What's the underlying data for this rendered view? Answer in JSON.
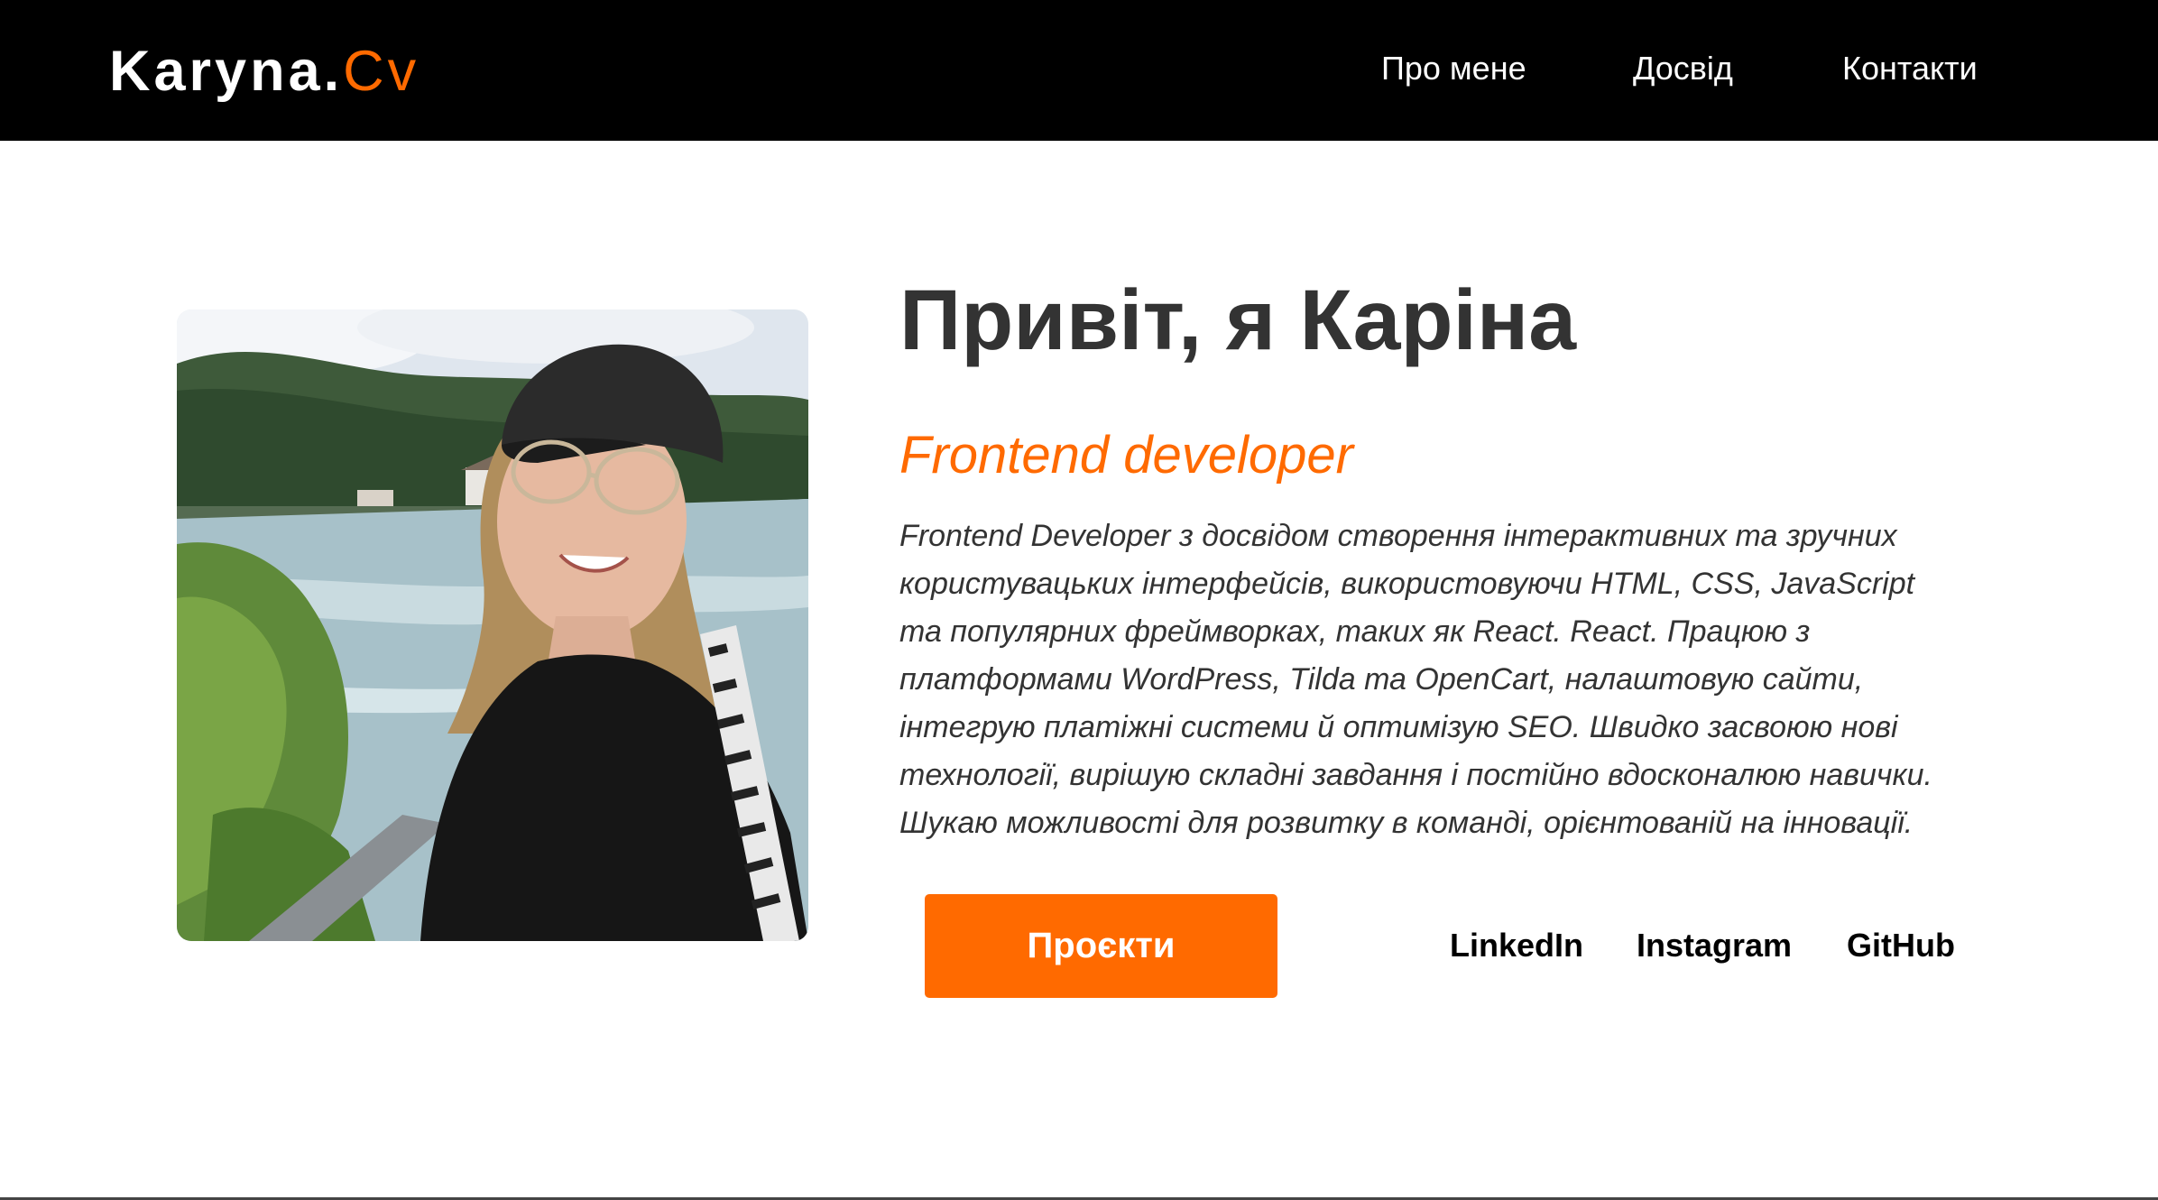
{
  "header": {
    "logo_main": "Karyna.",
    "logo_accent": "Cv",
    "nav": [
      {
        "label": "Про мене"
      },
      {
        "label": "Досвід"
      },
      {
        "label": "Контакти"
      }
    ]
  },
  "hero": {
    "title": "Привіт, я Каріна",
    "subtitle": "Frontend developer",
    "description_lines": [
      "Frontend Developer з досвідом створення інтерактивних та зручних",
      "користувацьких інтерфейсів, використовуючи HTML, CSS, JavaScript",
      "та популярних фреймворках, таких як React. React. Працюю з",
      "платформами WordPress, Tilda та OpenCart, налаштовую сайти,",
      "інтегрую платіжні системи й оптимізую SEO. Швидко засвоюю нові",
      "технології, вирішую складні завдання і постійно вдосконалюю навички.",
      "Шукаю можливості для розвитку в команді, орієнтованій на інновації."
    ],
    "projects_button": "Проєкти",
    "social": [
      {
        "label": "LinkedIn"
      },
      {
        "label": "Instagram"
      },
      {
        "label": "GitHub"
      }
    ]
  },
  "colors": {
    "accent": "#ff6a00",
    "header_bg": "#000000",
    "text_dark": "#333333"
  }
}
